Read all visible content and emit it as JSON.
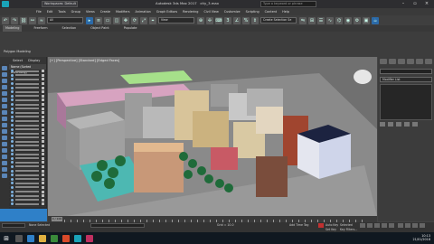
{
  "titlebar": {
    "workspace": "Workspaces: Default",
    "filename": "city_3.max",
    "title": "Autodesk 3ds Max 2017",
    "search_placeholder": "Type a keyword or phrase"
  },
  "menubar": {
    "items": [
      "File",
      "Edit",
      "Tools",
      "Group",
      "Views",
      "Create",
      "Modifiers",
      "Animation",
      "Graph Editors",
      "Rendering",
      "Civil View",
      "Customize",
      "Scripting",
      "Content",
      "Help"
    ]
  },
  "toolbar": {
    "selection_filter": "All",
    "view_set": "View",
    "named_selection": "Create Selection Se"
  },
  "ribbon": {
    "tabs": [
      "Modeling",
      "Freeform",
      "Selection",
      "Object Paint",
      "Populate"
    ],
    "active_tab": "Modeling",
    "panel_button": "Polygon Modeling"
  },
  "scene_explorer": {
    "tabs": [
      "Select",
      "Display"
    ],
    "header": "Name (Sorted Ascending)"
  },
  "viewport": {
    "label": "[+] [Perspective] [Standard] [Edged Faces]"
  },
  "command_panel": {
    "name_field": "",
    "modifier_list": "Modifier List"
  },
  "timeline": {
    "frame": "0 / 100"
  },
  "statusbar": {
    "status_text": "None Selected",
    "grid": "Grid = 10.0",
    "auto_key": "Auto Key",
    "set_key": "Set Key",
    "selected": "Selected",
    "key_filters": "Key Filters...",
    "add_time_tag": "Add Time Tag"
  },
  "taskbar": {
    "time": "10:13",
    "date": "21/01/2018"
  },
  "colors": {
    "accent_blue": "#2f80c8",
    "toolbar_highlight": "#2b6aa8"
  }
}
